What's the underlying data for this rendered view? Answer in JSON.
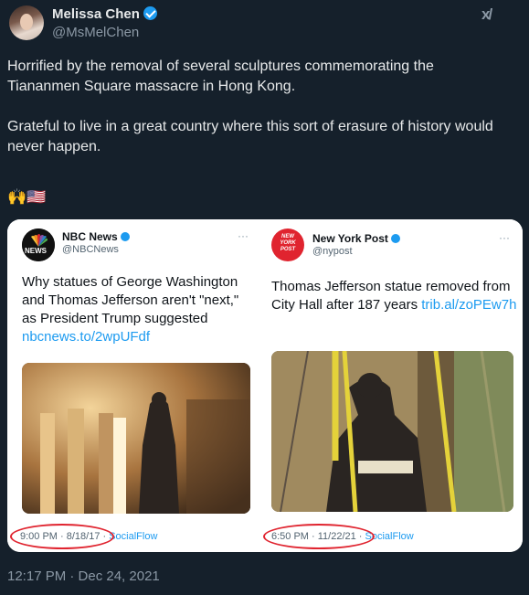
{
  "author": {
    "name": "Melissa Chen",
    "handle": "@MsMelChen"
  },
  "grok_icon": "xai-grok-icon",
  "tweet": {
    "paragraph1": "Horrified by the removal of several sculptures commemorating the Tiananmen Square massacre in Hong Kong.",
    "paragraph2": "Grateful to live in a great country where this sort of erasure of history would never happen.",
    "emoji": "🙌🇺🇸"
  },
  "embedded": {
    "left": {
      "name": "NBC News",
      "handle": "@NBCNews",
      "text": "Why statues of George Washington and Thomas Jefferson aren't \"next,\" as President Trump suggested ",
      "link": "nbcnews.to/2wpUFdf",
      "time": "9:00 PM · 8/18/17 · ",
      "via": "SocialFlow"
    },
    "right": {
      "name": "New York Post",
      "handle": "@nypost",
      "logo_text": "NEW YORK POST",
      "text": "Thomas Jefferson statue removed from City Hall after 187 years ",
      "link": "trib.al/zoPEw7h",
      "time": "6:50 PM · 11/22/21 · ",
      "via": "SocialFlow"
    },
    "nbc_logo_text": "NEWS",
    "more": "···"
  },
  "timestamp": "12:17 PM · Dec 24, 2021"
}
